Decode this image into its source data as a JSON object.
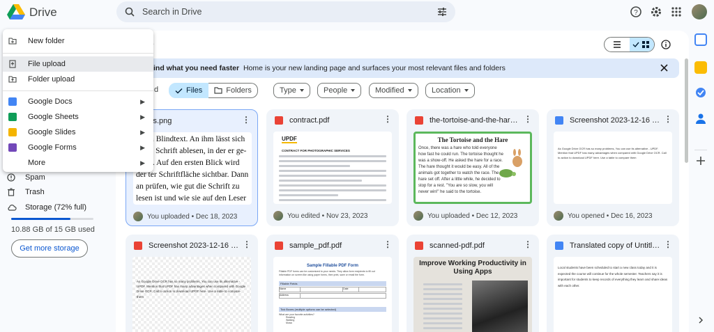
{
  "header": {
    "brand": "Drive",
    "search_placeholder": "Search in Drive"
  },
  "page": {
    "title": "e"
  },
  "banner": {
    "bold": "ind what you need faster",
    "text": "Home is your new landing page and surfaces your most relevant files and folders"
  },
  "filters": {
    "left_partial": "d",
    "files": "Files",
    "folders": "Folders",
    "type": "Type",
    "people": "People",
    "modified": "Modified",
    "location": "Location"
  },
  "menu": {
    "items": [
      {
        "label": "New folder",
        "has_submenu": false
      },
      {
        "label": "File upload",
        "has_submenu": false
      },
      {
        "label": "Folder upload",
        "has_submenu": false
      },
      {
        "label": "Google Docs",
        "has_submenu": true
      },
      {
        "label": "Google Sheets",
        "has_submenu": true
      },
      {
        "label": "Google Slides",
        "has_submenu": true
      },
      {
        "label": "Google Forms",
        "has_submenu": true
      },
      {
        "label": "More",
        "has_submenu": true
      }
    ],
    "arrow": "▶"
  },
  "sidebar": {
    "spam": "Spam",
    "trash": "Trash",
    "storage": "Storage (72% full)",
    "storage_used": "10.88 GB of 15 GB used",
    "storage_fraction": 0.72,
    "get_more": "Get more storage"
  },
  "files": [
    {
      "name": "ss.png",
      "activity": "You uploaded • Dec 18, 2023",
      "type": "image"
    },
    {
      "name": "contract.pdf",
      "activity": "You edited • Nov 23, 2023",
      "type": "pdf"
    },
    {
      "name": "the-tortoise-and-the-hare-st...",
      "activity": "You uploaded • Dec 12, 2023",
      "type": "pdf"
    },
    {
      "name": "Screenshot 2023-12-16 023156",
      "activity": "You opened • Dec 16, 2023",
      "type": "doc"
    },
    {
      "name": "Screenshot 2023-12-16 023156...",
      "activity": "",
      "type": "image"
    },
    {
      "name": "sample_pdf.pdf",
      "activity": "",
      "type": "pdf"
    },
    {
      "name": "scanned-pdf.pdf",
      "activity": "",
      "type": "pdf"
    },
    {
      "name": "Translated copy of Untitled do...",
      "activity": "",
      "type": "doc"
    }
  ],
  "thumbs": {
    "german": "ss ein Blindtext. An ihm lässt sich ie die Schrift ablesen, in der er ge- rit ist. Auf den ersten Blick wird der ter Schriftfläche sichtbar. Dann an prüfen, wie gut die Schrift zu lesen ist und wie sie auf den Leser wirkt. Dies ist ein Blindtext. An ihm lässt sich vieles über die Schrift ablesen, in der er gesetzt ist. Auf den ersten Blick wird der",
    "updf": "UPDF",
    "contract": "CONTRACT FOR PHOTOGRAPHIC SERVICES",
    "tortoise_title": "The Tortoise and the Hare",
    "tortoise_text": "Once, there was a hare who told everyone how fast he could run. The tortoise thought he was a show-off. He asked the hare for a race. The hare thought it would be easy. All of the animals got together to watch the race. The hare set off. After a little while, he decided to stop for a rest. \"You are so slow, you will never win!\" he said to the tortoise.",
    "ocr": "As Google Drive OCR has so many problems, You can use its alternative - UPDF. Mention that UPDF has many advantages when compared with Google Drive OCR. Call to action to download UPDF here. Use a table to compare them",
    "sample_title": "Sample Fillable PDF Form",
    "sample_sub": "Fillable PDF forms can be customized to your needs. They allow form recipients to fill out information on screen like using paper forms, then print, save or email the form.",
    "sample_fields": "Fillable Fields",
    "sample_name": "Name",
    "sample_date": "Date",
    "sample_address": "Address",
    "sample_checks": "Tick Boxes (multiple options can be selected)",
    "sample_q": "What are your favorite activities?",
    "sample_opts": [
      "Reading",
      "Walking",
      "Music"
    ],
    "scanned_title": "Improve Working Productivity in Using Apps",
    "translated": "Local students have been scheduled to start a new class today and it is expected the course will continue for the whole semester. Teachers say it is important for students to keep records of everything they learn and share ideas with each other."
  }
}
